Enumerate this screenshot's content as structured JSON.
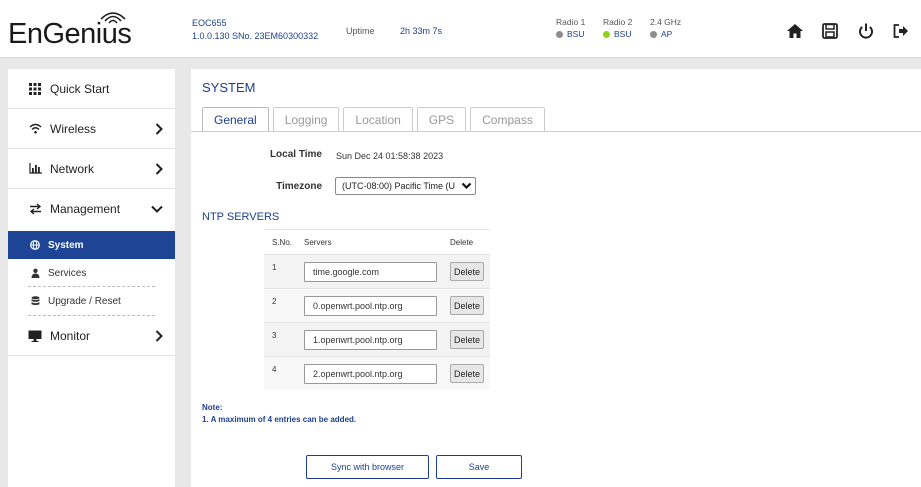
{
  "header": {
    "brand": "EnGenius",
    "device_model": "EOC655",
    "device_version": "1.0.0.130 SNo. 23EM60300332",
    "uptime_label": "Uptime",
    "uptime_value": "2h 33m 7s",
    "radios": [
      {
        "label": "Radio 1",
        "value": "BSU",
        "color": "#8c8c8c"
      },
      {
        "label": "Radio 2",
        "value": "BSU",
        "color": "#8fd11d"
      },
      {
        "label": "2.4 GHz",
        "value": "AP",
        "color": "#8c8c8c"
      }
    ],
    "icons": [
      "home-icon",
      "save-icon",
      "power-icon",
      "logout-icon"
    ]
  },
  "sidebar": {
    "items": [
      {
        "label": "Quick Start",
        "icon": "grid-icon"
      },
      {
        "label": "Wireless",
        "icon": "wifi-icon",
        "chevron": "right"
      },
      {
        "label": "Network",
        "icon": "bar-chart-icon",
        "chevron": "right"
      },
      {
        "label": "Management",
        "icon": "transfer-icon",
        "chevron": "down"
      },
      {
        "label": "Monitor",
        "icon": "monitor-icon",
        "chevron": "right"
      }
    ],
    "subitems": [
      {
        "label": "System",
        "icon": "globe-icon",
        "active": true
      },
      {
        "label": "Services",
        "icon": "user-icon",
        "active": false
      },
      {
        "label": "Upgrade / Reset",
        "icon": "database-icon",
        "active": false
      }
    ]
  },
  "main": {
    "title": "SYSTEM",
    "tabs": [
      {
        "label": "General",
        "active": true
      },
      {
        "label": "Logging",
        "active": false
      },
      {
        "label": "Location",
        "active": false
      },
      {
        "label": "GPS",
        "active": false
      },
      {
        "label": "Compass",
        "active": false
      }
    ],
    "local_time_label": "Local Time",
    "local_time_value": "Sun Dec 24 01:58:38 2023",
    "timezone_label": "Timezone",
    "timezone_value": "(UTC-08:00) Pacific Time (U",
    "ntp_title": "NTP SERVERS",
    "ntp_headers": {
      "sno": "S.No.",
      "servers": "Servers",
      "delete": "Delete"
    },
    "ntp_rows": [
      {
        "sno": "1",
        "server": "time.google.com",
        "delete_label": "Delete"
      },
      {
        "sno": "2",
        "server": "0.openwrt.pool.ntp.org",
        "delete_label": "Delete"
      },
      {
        "sno": "3",
        "server": "1.openwrt.pool.ntp.org",
        "delete_label": "Delete"
      },
      {
        "sno": "4",
        "server": "2.openwrt.pool.ntp.org",
        "delete_label": "Delete"
      }
    ],
    "note_title": "Note:",
    "note_text": "1. A maximum of 4 entries can be added.",
    "sync_button": "Sync with browser",
    "save_button": "Save"
  },
  "colors": {
    "accent": "#1e3f8f",
    "active_bg": "#1e4496"
  }
}
